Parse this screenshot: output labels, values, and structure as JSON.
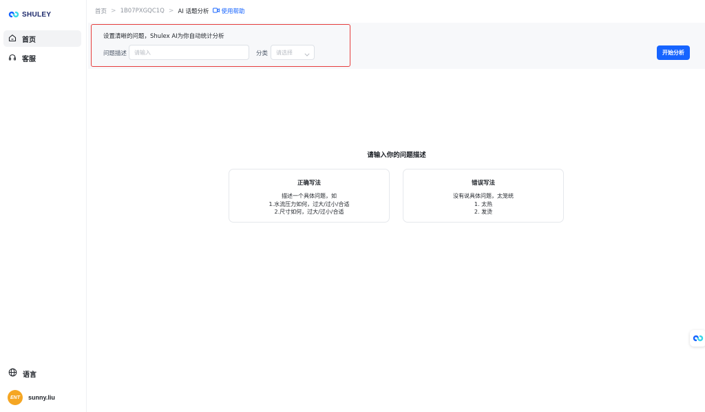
{
  "brand": {
    "name": "SHULEY"
  },
  "sidebar": {
    "items": [
      {
        "label": "首页",
        "icon": "home-icon",
        "active": true
      },
      {
        "label": "客服",
        "icon": "headset-icon",
        "active": false
      }
    ],
    "language": {
      "label": "语言",
      "icon": "globe-icon"
    },
    "user": {
      "avatar_text": "ENT",
      "name": "sunny.liu"
    }
  },
  "breadcrumb": {
    "items": [
      "首页",
      "1B07PXGQC1Q",
      "AI 话题分析"
    ],
    "help_label": "使用帮助"
  },
  "filter": {
    "title": "设置清晰的问题，Shulex AI为你自动统计分析",
    "desc_label": "问题描述",
    "desc_placeholder": "请输入",
    "category_label": "分类",
    "category_placeholder": "请选择",
    "start_button": "开始分析"
  },
  "empty_state": {
    "title": "请输入你的问题描述",
    "correct": {
      "title": "正确写法",
      "lines": [
        "描述一个具体问题，如",
        "1.水流压力如何，过大/过小/合适",
        "2.尺寸如何，过大/过小/合适"
      ]
    },
    "wrong": {
      "title": "错误写法",
      "lines": [
        "没有说具体问题，太笼统",
        "1. 太热",
        "2. 发烫"
      ]
    }
  },
  "colors": {
    "accent": "#1664ff",
    "highlight_border": "#e63c3c",
    "avatar_bg": "#f5a623",
    "panel_bg": "#f7f8fa"
  }
}
